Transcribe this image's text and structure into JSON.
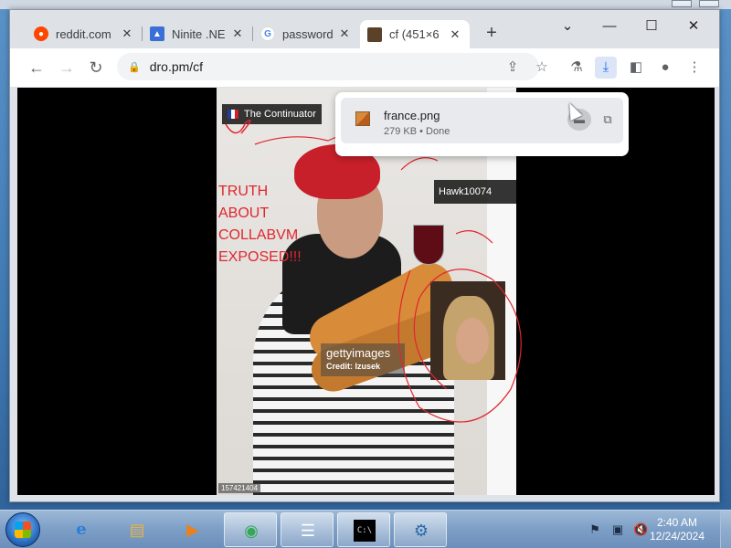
{
  "browser": {
    "tabs": [
      {
        "title": "reddit.com",
        "favicon": "reddit-icon",
        "color": "#ff4500",
        "active": false
      },
      {
        "title": "Ninite .NE",
        "favicon": "ninite-icon",
        "color": "#3a6fd8",
        "active": false
      },
      {
        "title": "password",
        "favicon": "google-icon",
        "color": "#4285f4",
        "active": false
      },
      {
        "title": "cf (451×6",
        "favicon": "image-icon",
        "color": "#5a4128",
        "active": true
      }
    ],
    "new_tab_label": "+",
    "window_controls": {
      "chevron": "⌄",
      "minimize": "—",
      "maximize": "☐",
      "close": "✕"
    },
    "nav": {
      "back": "←",
      "forward": "→",
      "reload": "↻"
    },
    "address": "dro.pm/cf",
    "toolbar_icons": [
      "share-icon",
      "star-icon",
      "labs-icon",
      "download-icon",
      "sidepanel-icon",
      "profile-icon",
      "menu-icon"
    ]
  },
  "download_bubble": {
    "filename": "france.png",
    "meta": "279 KB • Done",
    "folder_icon": "folder-icon",
    "open_icon": "external-open-icon"
  },
  "page": {
    "name_tag": "The Continuator",
    "scrawl": "TRUTH\nABOUT\nCOLLABVM\nEXPOSED!!!",
    "hawk_tag": "Hawk10074",
    "getty_brand": "gettyimages",
    "getty_credit": "Credit: Izusek",
    "stock_id": "157421404"
  },
  "taskbar": {
    "start": "windows-start-icon",
    "apps": [
      {
        "name": "internet-explorer-icon",
        "glyph": "e",
        "state": "pinned"
      },
      {
        "name": "file-explorer-icon",
        "glyph": "▤",
        "state": "pinned"
      },
      {
        "name": "media-player-icon",
        "glyph": "▶",
        "state": "pinned"
      },
      {
        "name": "chrome-icon",
        "glyph": "◉",
        "state": "running"
      },
      {
        "name": "task-list-icon",
        "glyph": "☰",
        "state": "running"
      },
      {
        "name": "command-prompt-icon",
        "glyph": "C:\\",
        "state": "running"
      },
      {
        "name": "control-panel-icon",
        "glyph": "⚙",
        "state": "running"
      }
    ],
    "tray": [
      "flag-icon",
      "network-icon",
      "volume-muted-icon"
    ],
    "clock": {
      "time": "2:40 AM",
      "date": "12/24/2024"
    }
  }
}
